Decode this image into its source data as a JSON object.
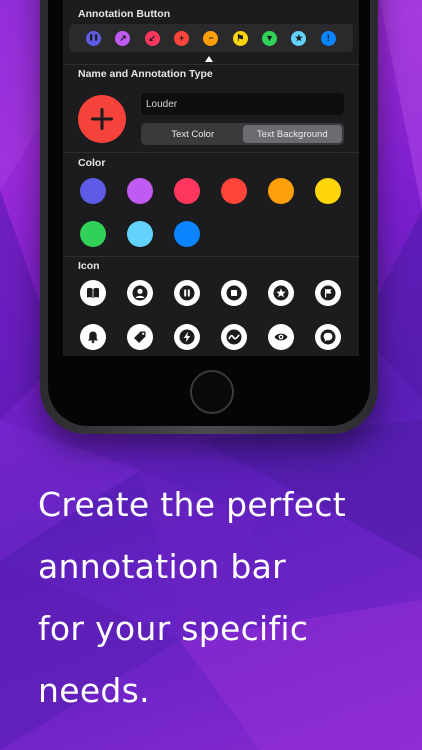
{
  "screen": {
    "annotation_button": {
      "title": "Annotation Button",
      "buttons": [
        {
          "icon": "pause-icon",
          "color": "#5e5ce6",
          "glyph": "❚❚"
        },
        {
          "icon": "arrow-up-right-icon",
          "color": "#bf5af2",
          "glyph": "↗"
        },
        {
          "icon": "arrow-down-left-icon",
          "color": "#ff375f",
          "glyph": "↙"
        },
        {
          "icon": "plus-icon",
          "color": "#ff453a",
          "glyph": "+"
        },
        {
          "icon": "minus-icon",
          "color": "#ff9f0a",
          "glyph": "−"
        },
        {
          "icon": "flag-icon",
          "color": "#ffd60a",
          "glyph": "⚑"
        },
        {
          "icon": "triangle-down-icon",
          "color": "#30d158",
          "glyph": "▼"
        },
        {
          "icon": "star-icon",
          "color": "#64d2ff",
          "glyph": "★"
        },
        {
          "icon": "exclamation-icon",
          "color": "#0a84ff",
          "glyph": "!"
        }
      ]
    },
    "name_type": {
      "title": "Name and Annotation Type",
      "name_value": "Louder",
      "segments": [
        "Text Color",
        "Text Background"
      ],
      "selected_segment": "Text Background",
      "preview_color": "#f5423a"
    },
    "color": {
      "title": "Color",
      "swatches": [
        "#5e5ce6",
        "#bf5af2",
        "#ff375f",
        "#ff453a",
        "#ff9f0a",
        "#ffd60a",
        "#30d158",
        "#64d2ff",
        "#0a84ff"
      ]
    },
    "icon": {
      "title": "Icon",
      "icons": [
        "book-icon",
        "person-icon",
        "pause-icon",
        "stop-icon",
        "star-icon",
        "flag-icon",
        "bell-icon",
        "tag-icon",
        "bolt-icon",
        "waveform-icon",
        "eye-icon",
        "speech-bubble-icon"
      ]
    }
  },
  "headline": {
    "lines": [
      "Create the perfect",
      "annotation bar",
      "for your specific",
      "needs."
    ]
  }
}
